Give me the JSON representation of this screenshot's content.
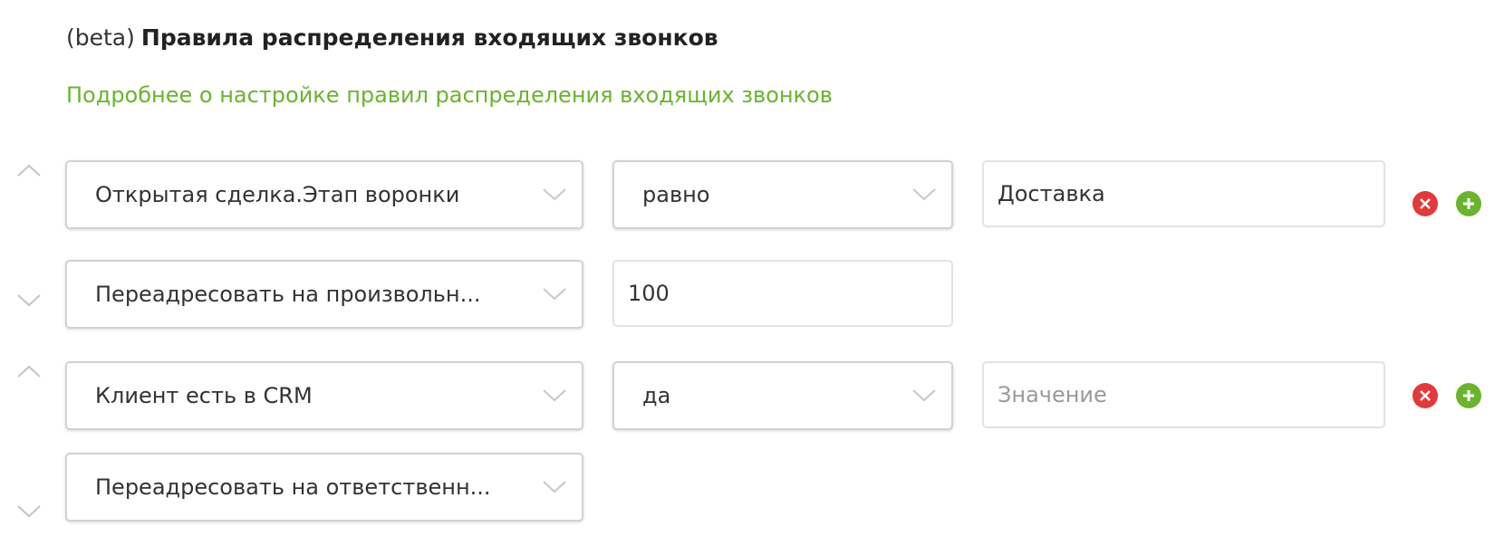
{
  "header": {
    "prefix": "(beta)",
    "title": "Правила распределения входящих звонков"
  },
  "help_link": "Подробнее о настройке правил распределения входящих звонков",
  "colors": {
    "accent_green": "#6ab42d",
    "remove_red": "#e23a3a",
    "border": "#dcdcdc",
    "placeholder": "#9a9a9a"
  },
  "rules": [
    {
      "condition": {
        "field": "Открытая сделка.Этап воронки",
        "operator": "равно",
        "value": "Доставка",
        "value_placeholder": ""
      },
      "action": {
        "type": "Переадресовать на произвольн...",
        "value": "100"
      }
    },
    {
      "condition": {
        "field": "Клиент есть в CRM",
        "operator": "да",
        "value": "",
        "value_placeholder": "Значение"
      },
      "action": {
        "type": "Переадресовать на ответственн..."
      }
    }
  ],
  "icons": {
    "move_up": "chevron-up-icon",
    "move_down": "chevron-down-icon",
    "dropdown": "chevron-down-icon",
    "remove": "remove-circle-icon",
    "add": "add-circle-icon"
  }
}
